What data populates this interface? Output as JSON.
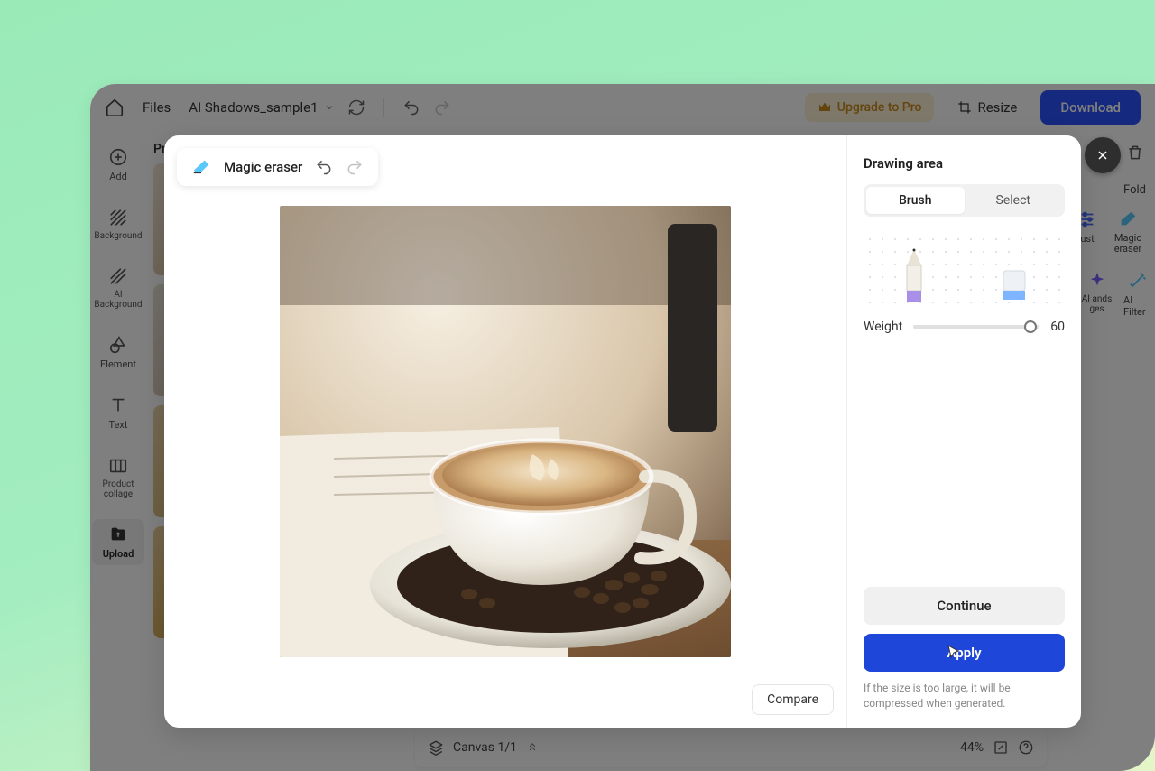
{
  "topbar": {
    "files_label": "Files",
    "doc_name": "AI Shadows_sample1",
    "upgrade_label": "Upgrade to Pro",
    "resize_label": "Resize",
    "download_label": "Download"
  },
  "sidebar": {
    "items": [
      {
        "label": "Add"
      },
      {
        "label": "Background"
      },
      {
        "label": "AI Background"
      },
      {
        "label": "Element"
      },
      {
        "label": "Text"
      },
      {
        "label": "Product collage"
      },
      {
        "label": "Upload"
      }
    ]
  },
  "thumb_panel": {
    "title": "Pr"
  },
  "right_tools": {
    "fold_label": "Fold",
    "tools": [
      {
        "label": "ust"
      },
      {
        "label": "Magic eraser"
      },
      {
        "label": "AI ands ges"
      },
      {
        "label": "AI Filter"
      }
    ]
  },
  "bottom_bar": {
    "canvas_label": "Canvas 1/1",
    "zoom": "44%"
  },
  "modal": {
    "tool_name": "Magic eraser",
    "compare_label": "Compare",
    "drawing_area_title": "Drawing area",
    "brush_label": "Brush",
    "select_label": "Select",
    "weight_label": "Weight",
    "weight_value": "60",
    "slider_percent": 93,
    "continue_label": "Continue",
    "apply_label": "Apply",
    "hint_text": "If the size is too large, it will be compressed when generated."
  },
  "colors": {
    "primary": "#1e47d9",
    "upgrade_bg": "#fdf0d4",
    "upgrade_fg": "#c78a1a"
  }
}
